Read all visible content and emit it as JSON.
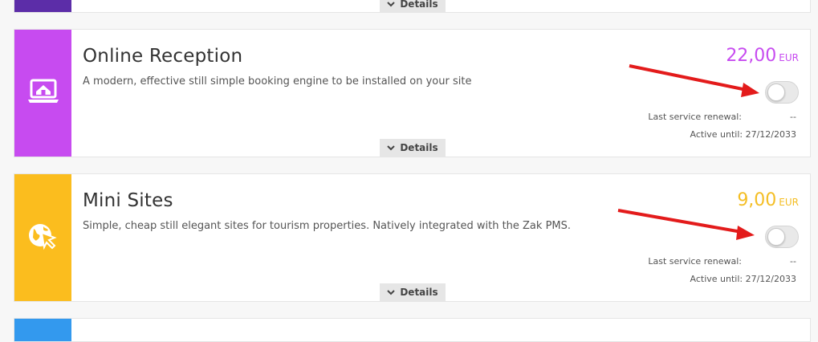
{
  "cards": [
    {
      "title": "Online Reception",
      "description": "A modern, effective still simple booking engine to be installed on your site",
      "price": "22,00",
      "currency": "EUR",
      "toggle_on": false,
      "renewal_label": "Last service renewal:",
      "renewal_value": "--",
      "active_until": "Active until: 27/12/2033",
      "details_label": "Details",
      "icon": "laptop-home-icon",
      "color": "#c74bf0"
    },
    {
      "title": "Mini Sites",
      "description": "Simple, cheap still elegant sites for tourism properties. Natively integrated with the Zak PMS.",
      "price": "9,00",
      "currency": "EUR",
      "toggle_on": false,
      "renewal_label": "Last service renewal:",
      "renewal_value": "--",
      "active_until": "Active until: 27/12/2033",
      "details_label": "Details",
      "icon": "globe-cursor-icon",
      "color": "#fbbd1e"
    }
  ],
  "top_card": {
    "details_label": "Details",
    "color": "#5c2da8"
  },
  "bottom_card": {
    "color": "#3399ee"
  },
  "annotation_color": "#e31b1b"
}
